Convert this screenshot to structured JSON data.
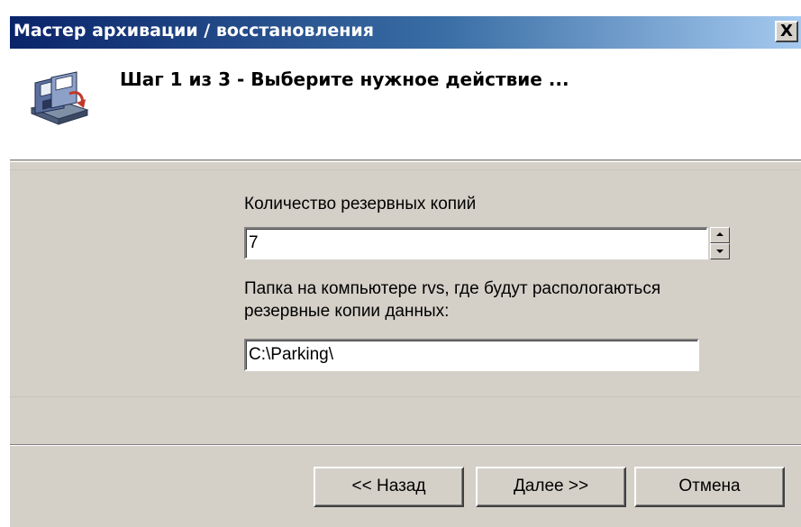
{
  "window": {
    "title": "Мастер архивации / восстановления",
    "close_label": "X"
  },
  "header": {
    "step_title": "Шаг 1 из 3 - Выберите нужное действие ...",
    "icon": "backup-wizard-icon"
  },
  "form": {
    "backup_count_label": "Количество резервных копий",
    "backup_count_value": "7",
    "folder_label": "Папка на компьютере rvs, где будут распологаються резервные копии данных:",
    "folder_value": "C:\\Parking\\"
  },
  "buttons": {
    "back_label": "<< Назад",
    "next_label": "Далее >>",
    "cancel_label": "Отмена"
  },
  "colors": {
    "title_bar_start": "#0a246a",
    "title_bar_end": "#a6caf0",
    "dialog_face": "#d4d0c8"
  }
}
